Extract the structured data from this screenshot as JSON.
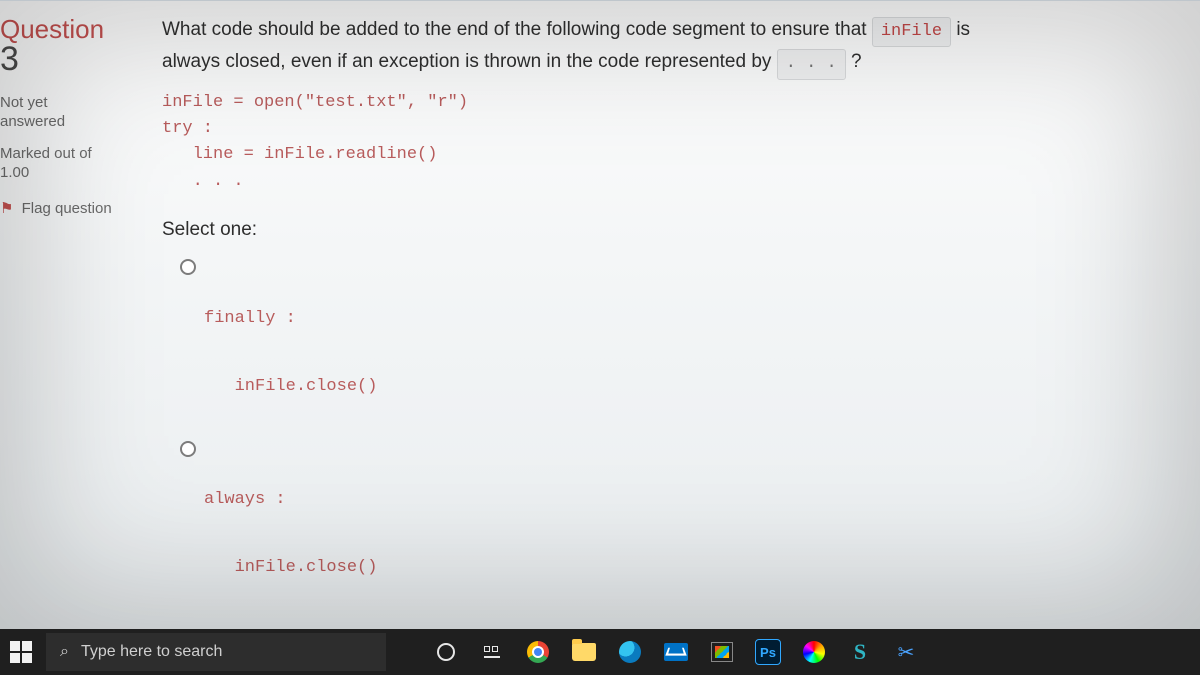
{
  "sidebar": {
    "question_label": "Question",
    "question_number": "3",
    "status_line1": "Not yet",
    "status_line2": "answered",
    "marks_line1": "Marked out of",
    "marks_line2": "1.00",
    "flag_label": "Flag question"
  },
  "question": {
    "text_part1": "What code should be added to the end of the following code segment to ensure that ",
    "code_inline1": "inFile",
    "text_part2": " is",
    "text_part3": "always closed, even if an exception is thrown in the code represented by ",
    "code_inline2": ". . .",
    "text_part4": " ?",
    "code_block": "inFile = open(\"test.txt\", \"r\")\ntry :\n   line = inFile.readline()\n   . . ."
  },
  "answers": {
    "select_label": "Select one:",
    "options": [
      {
        "code": "finally :\n\n   inFile.close()"
      },
      {
        "code": "always :\n\n   inFile.close()"
      }
    ]
  },
  "taskbar": {
    "search_placeholder": "Type here to search",
    "ps_label": "Ps"
  }
}
